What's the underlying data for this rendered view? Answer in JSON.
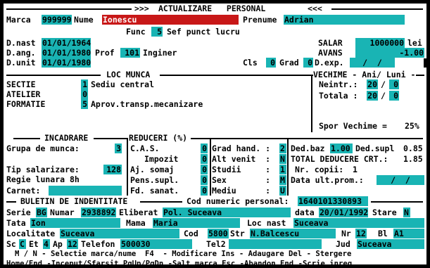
{
  "title": {
    "arrows_left": ">>>",
    "text": "ACTUALIZARE   PERSONAL",
    "arrows_right": "<<<"
  },
  "marca": {
    "label": "Marca",
    "value": "999999"
  },
  "nume": {
    "label": "Nume",
    "value": "Ionescu"
  },
  "prenume": {
    "label": "Prenume",
    "value": "Adrian"
  },
  "func": {
    "label": "Func",
    "code": "5",
    "name": "Sef punct lucru"
  },
  "d_nast": {
    "label": "D.nast",
    "value": "01/01/1964"
  },
  "d_ang": {
    "label": "D.ang.",
    "value": "01/01/1980"
  },
  "prof": {
    "label": "Prof",
    "code": "101",
    "name": "Inginer"
  },
  "d_unit": {
    "label": "D.unit",
    "value": "01/01/1980"
  },
  "salar": {
    "label": "SALAR",
    "value": "1000000",
    "unit": "lei"
  },
  "avans": {
    "label": "AVANS",
    "value": "-1.00"
  },
  "cls": {
    "label": "Cls",
    "value": "0"
  },
  "grad": {
    "label": "Grad",
    "value": "0"
  },
  "d_exp": {
    "label": "D.exp.",
    "value": "/  /"
  },
  "loc_munca": {
    "title": "LOC MUNCA",
    "sectie": {
      "label": "SECTIE",
      "code": "1",
      "name": "Sediu central"
    },
    "atelier": {
      "label": "ATELIER",
      "code": "0"
    },
    "formatie": {
      "label": "FORMATIE",
      "code": "5",
      "name": "Aprov.transp.mecanizare"
    }
  },
  "vechime": {
    "title": "VECHIME - Ani/ Luni -",
    "neintr": {
      "label": "Neintr.:",
      "ani": "20",
      "luni": "0"
    },
    "totala": {
      "label": "Totala :",
      "ani": "20",
      "luni": "0"
    },
    "spor": {
      "label": "Spor Vechime =",
      "value": "25%"
    }
  },
  "incadrare": {
    "title": "INCADRARE",
    "grupa": {
      "label": "Grupa de munca:",
      "value": "3"
    },
    "tip_sal": {
      "label": "Tip salarizare:",
      "value": "128"
    },
    "regie": "Regie lunara 8h",
    "carnet": {
      "label": "Carnet:",
      "value": ""
    }
  },
  "reduceri": {
    "title": "REDUCERI (%)",
    "items": [
      {
        "label": "C.A.S.",
        "value": "0"
      },
      {
        "label": "Impozit",
        "value": "0"
      },
      {
        "label": "Aj. somaj",
        "value": "0"
      },
      {
        "label": "Pens.supl.",
        "value": "0"
      },
      {
        "label": "Fd. sanat.",
        "value": "0"
      }
    ]
  },
  "misc": {
    "items": [
      {
        "label": "Grad hand. :",
        "value": "2"
      },
      {
        "label": "Alt venit  :",
        "value": "N"
      },
      {
        "label": "Studii     :",
        "value": "1"
      },
      {
        "label": "Sex        :",
        "value": "M"
      },
      {
        "label": "Mediu      :",
        "value": "U"
      }
    ]
  },
  "deduceri": {
    "ded_baz": {
      "label": "Ded.baz",
      "value": "1.00"
    },
    "ded_supl": {
      "label": "Ded.supl",
      "value": "0.85"
    },
    "total": {
      "label": "TOTAL DEDUCERE CRT.:",
      "value": "1.85"
    },
    "copii": {
      "label": "Nr. copii:",
      "value": "1"
    },
    "data_ult": {
      "label": "Data ult.prom.:",
      "value": "/  /"
    }
  },
  "buletin": {
    "title": "BULETIN DE INDENTITATE",
    "cnp": {
      "label": "Cod numeric personal:",
      "value": "1640101330893"
    },
    "serie": {
      "label": "Serie",
      "value": "BG"
    },
    "numar": {
      "label": "Numar",
      "value": "2938892"
    },
    "eliberat": {
      "label": "Eliberat",
      "value": "Pol. Suceava"
    },
    "data": {
      "label": "data",
      "value": "20/01/1992"
    },
    "stare": {
      "label": "Stare",
      "value": "N"
    },
    "tata": {
      "label": "Tata",
      "value": "Ion"
    },
    "mama": {
      "label": "Mama",
      "value": "Maria"
    },
    "loc_nast": {
      "label": "Loc nast",
      "value": "Suceava"
    },
    "localitate": {
      "label": "Localitate",
      "value": "Suceava"
    },
    "cod": {
      "label": "Cod",
      "value": "5800"
    },
    "str": {
      "label": "Str",
      "value": "N.Balcescu"
    },
    "nr": {
      "label": "Nr",
      "value": "12"
    },
    "bl": {
      "label": "Bl",
      "value": "A1"
    },
    "sc": {
      "label": "Sc",
      "value": "C"
    },
    "et": {
      "label": "Et",
      "value": "4"
    },
    "ap": {
      "label": "Ap",
      "value": "12"
    },
    "telefon": {
      "label": "Telefon",
      "value": "500030"
    },
    "tel2": {
      "label": "Tel2",
      "value": ""
    },
    "jud": {
      "label": "Jud",
      "value": "Suceava"
    }
  },
  "help": {
    "line1": "M / N - Selectie marca/nume  F4  - Modificare Ins - Adaugare Del - Stergere",
    "line2": "Home/End -Inceput/Sfarsit PgUp/PgDn -Salt marca Esc -Abandon End -Scrie inreg"
  },
  "colors": {
    "field": "#19b4b4",
    "highlight": "#c81818",
    "background": "#ffffff",
    "text": "#000000"
  }
}
